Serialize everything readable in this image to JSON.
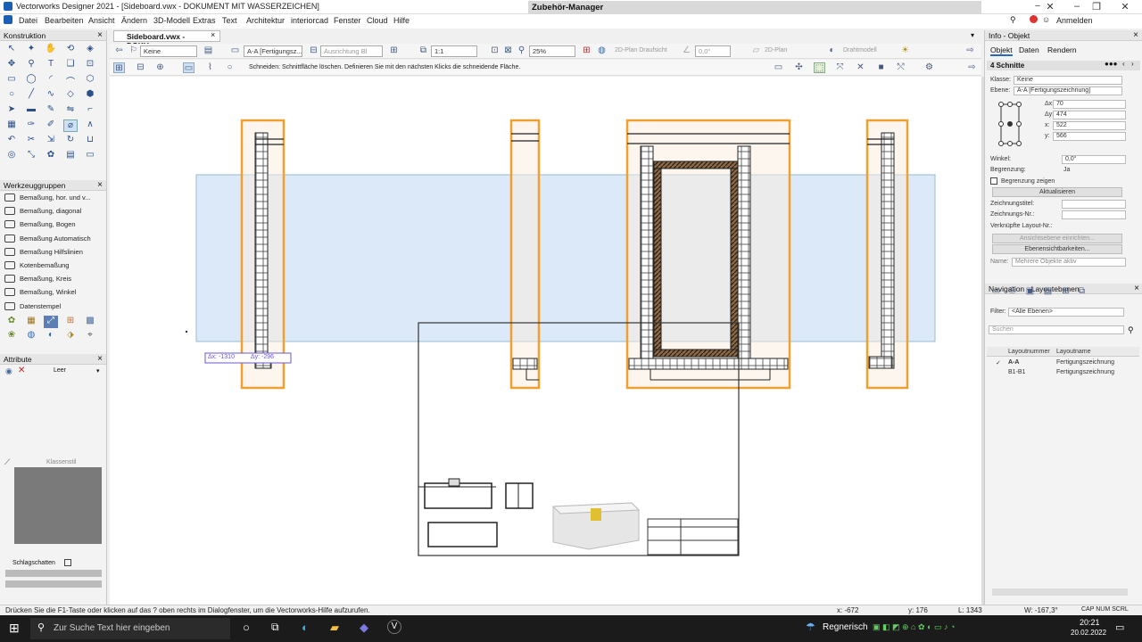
{
  "window": {
    "title": "Vectorworks Designer 2021 - [Sideboard.vwx - DOKUMENT MIT WASSERZEICHEN]",
    "accessory_manager": "Zubehör-Manager"
  },
  "menu": [
    "Datei",
    "Bearbeiten",
    "Ansicht",
    "Ändern",
    "3D-Modell",
    "Extras",
    "Text",
    "Architektur",
    "interiorcad",
    "Fenster",
    "Cloud",
    "Hilfe"
  ],
  "menu_right": {
    "login": "Anmelden"
  },
  "panels": {
    "construction": "Konstruktion",
    "toolsets": "Werkzeuggruppen",
    "toolset_items": [
      "Bemaßung, hor. und v...",
      "Bemaßung, diagonal",
      "Bemaßung, Bogen",
      "Bemaßung Automatisch",
      "Bemaßung Hilfslinien",
      "Kotenbemaßung",
      "Bemaßung, Kreis",
      "Bemaßung, Winkel",
      "Datenstempel"
    ],
    "attributes": "Attribute",
    "attr_fill": "Leer",
    "attr_pen": "Klassenstil",
    "shadow": "Schlagschatten"
  },
  "doc": {
    "tab": "Sideboard.vwx - DOKU...",
    "close": "×"
  },
  "viewbar": {
    "class": "Keine",
    "layer": "A-A [Fertigungsz...",
    "orientation": "Ausrichtung Bl",
    "scale": "1:1",
    "zoom": "25%",
    "view": "2D-Plan Draufsicht",
    "angle": "0,0°",
    "plan": "2D-Plan",
    "render": "Drahtmodell"
  },
  "mode_hint": "Schneiden: Schnittfläche löschen. Definieren Sie mit den nächsten Klicks die schneidende Fläche.",
  "canvas": {
    "dx": "Δx: -1310",
    "dy": "Δy: -296"
  },
  "info": {
    "header": "Info - Objekt",
    "tabs": [
      "Objekt",
      "Daten",
      "Rendern"
    ],
    "selection": "4 Schnitte",
    "class_label": "Klasse:",
    "class_value": "Keine",
    "layer_label": "Ebene:",
    "layer_value": "A-A [Fertigungszeichnung]",
    "fields": [
      {
        "label": "Δx:",
        "value": "70"
      },
      {
        "label": "Δy:",
        "value": "474"
      },
      {
        "label": "x:",
        "value": "522"
      },
      {
        "label": "y:",
        "value": "566"
      }
    ],
    "angle_label": "Winkel:",
    "angle_value": "0,0°",
    "bound_label": "Begrenzung:",
    "bound_value": "Ja",
    "show_bound": "Begrenzung zeigen",
    "update": "Aktualisieren",
    "drawing_title": "Zeichnungstitel:",
    "drawing_no": "Zeichnungs-Nr.:",
    "layout_no": "Verknüpfte Layout-Nr.:",
    "settings_btn": "Ansichtsebene einrichten...",
    "visibility_btn": "Ebenensichtbarkeiten...",
    "name_label": "Name:",
    "name_value": "Mehrere Objekte aktiv"
  },
  "nav": {
    "header": "Navigation - Layoutebenen",
    "filter_label": "Filter:",
    "filter_value": "<Alle Ebenen>",
    "search": "Suchen",
    "columns": [
      "Layoutnummer",
      "Layoutname"
    ],
    "rows": [
      {
        "no": "A-A",
        "name": "Fertigungszeichnung"
      },
      {
        "no": "B1-B1",
        "name": "Fertigungszeichnung"
      }
    ]
  },
  "status": {
    "hint": "Drücken Sie die F1-Taste oder klicken auf das ? oben rechts im Dialogfenster, um die Vectorworks-Hilfe aufzurufen.",
    "x": "x: -672",
    "y": "y: 176",
    "l": "L: 1343",
    "w": "W: -167,3°",
    "caps": "CAP NUM SCRL"
  },
  "taskbar": {
    "search": "Zur Suche Text hier eingeben",
    "weather": "Regnerisch",
    "time": "20:21",
    "date": "20.02.2022"
  },
  "colors": {
    "selection": "#f0a030",
    "cut_area": "#cfe2f5",
    "taskbar": "#1b1b1b"
  }
}
